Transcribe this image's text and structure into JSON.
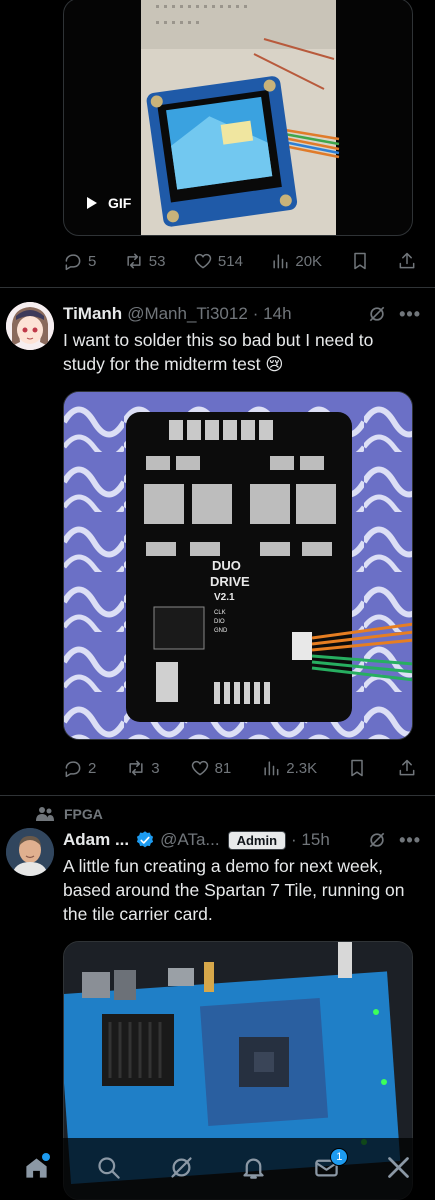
{
  "tweet1": {
    "media": {
      "type_label": "GIF"
    },
    "actions": {
      "replies": "5",
      "reposts": "53",
      "likes": "514",
      "views": "20K"
    }
  },
  "tweet2": {
    "author_name": "TiManh",
    "handle": "@Manh_Ti3012",
    "time": "· 14h",
    "text": "I want to solder this so bad but I need to study for the midterm test 😢",
    "board": {
      "label_line1": "DUO",
      "label_line2": "DRIVE",
      "version": "V2.1",
      "pins": [
        "CLK",
        "DIO",
        "GND"
      ]
    },
    "actions": {
      "replies": "2",
      "reposts": "3",
      "likes": "81",
      "views": "2.3K"
    }
  },
  "tweet3": {
    "community": "FPGA",
    "author_name": "Adam ...",
    "handle": "@ATa...",
    "badge": "Admin",
    "time": "· 15h",
    "text": "A little fun creating a demo for next week, based around the Spartan 7 Tile, running on the tile carrier card."
  },
  "nav": {
    "notifications_count": "1"
  },
  "colors": {
    "accent": "#1d9bf0",
    "background": "#000000",
    "muted": "#71767b",
    "divider": "#2f3336"
  }
}
